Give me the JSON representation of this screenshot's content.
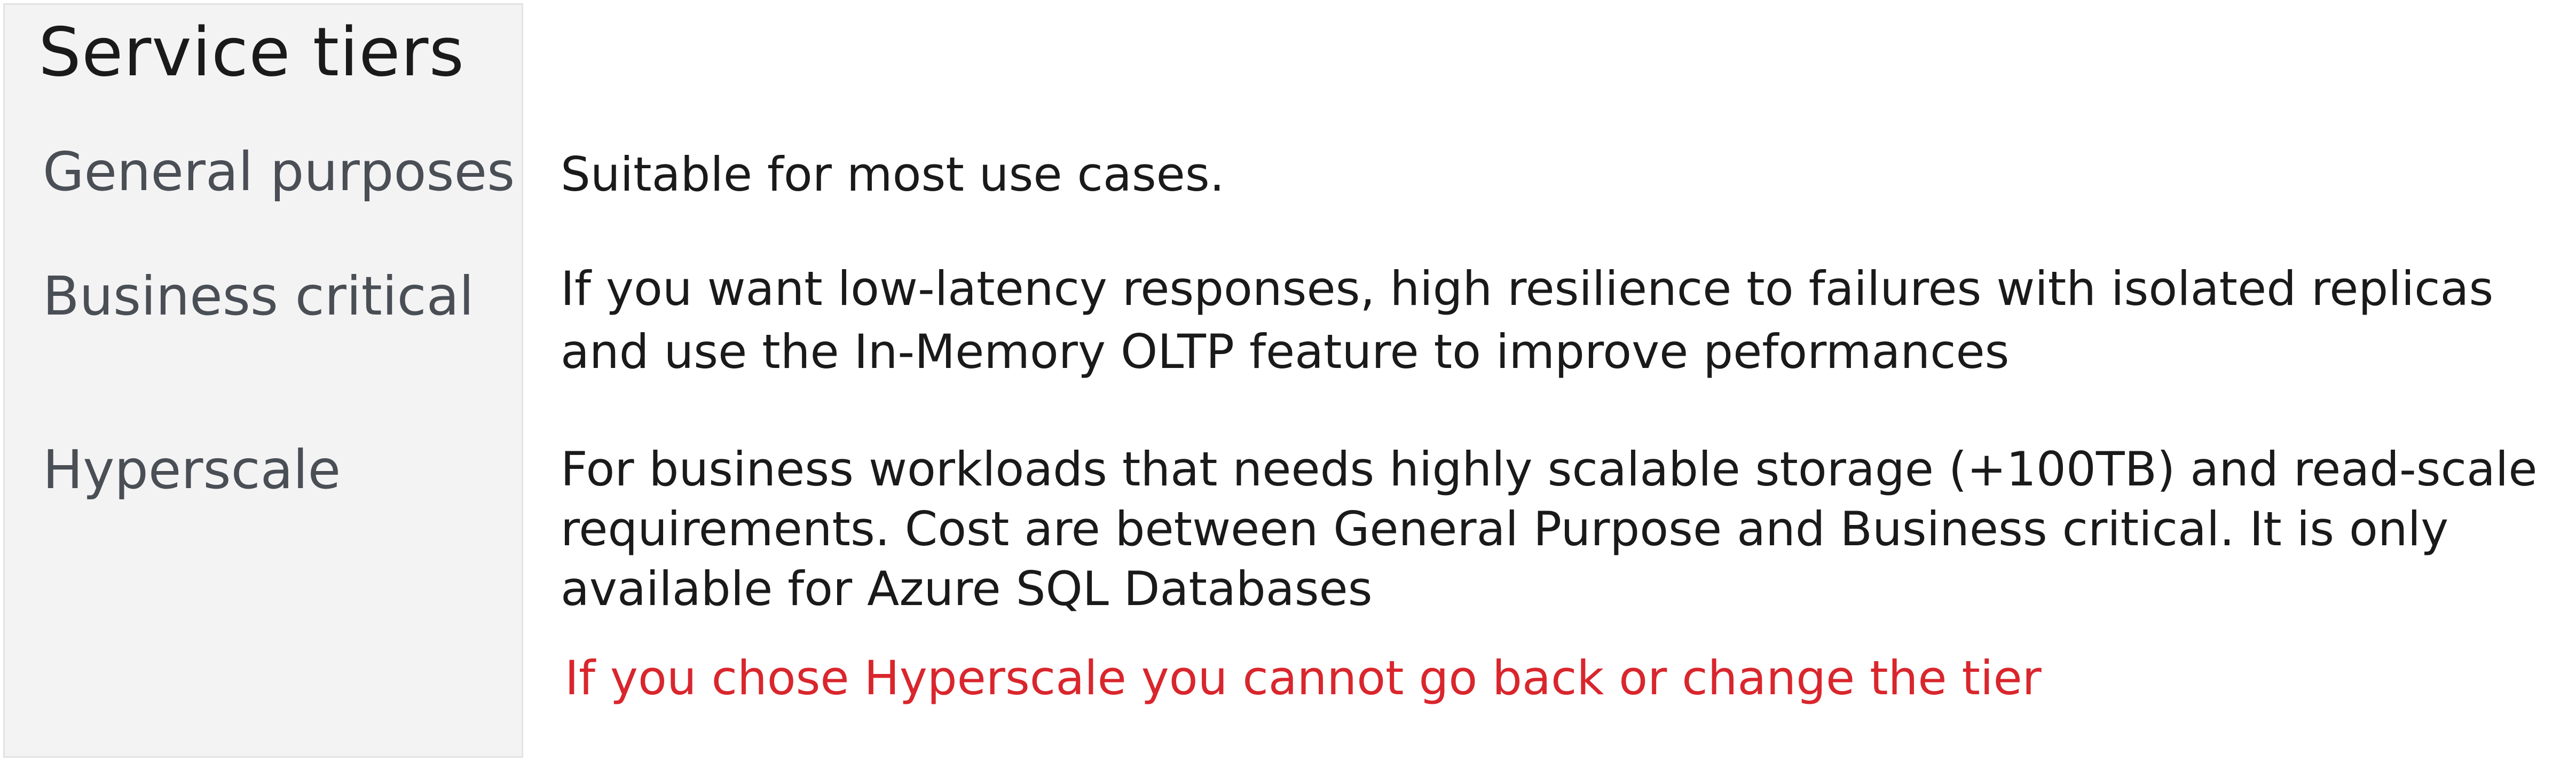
{
  "title": "Service tiers",
  "tiers": [
    {
      "name": "General purposes",
      "description": [
        "Suitable for most use cases."
      ]
    },
    {
      "name": "Business critical",
      "description": [
        "If you want low-latency responses, high resilience to failures with isolated replicas",
        "and use the In-Memory OLTP feature to improve peformances"
      ]
    },
    {
      "name": "Hyperscale",
      "description": [
        "For business workloads that needs highly scalable storage (+100TB) and read-scale",
        "requirements. Cost are between General Purpose and Business critical. It is only",
        "available for Azure SQL Databases"
      ]
    }
  ],
  "warning": {
    "text": "If you chose Hyperscale you cannot go back or change the tier",
    "color": "#d9262d"
  },
  "colors": {
    "sidebar_background": "#f3f3f4",
    "tier_name": "#4a4e55",
    "text": "#1a1a1a"
  }
}
